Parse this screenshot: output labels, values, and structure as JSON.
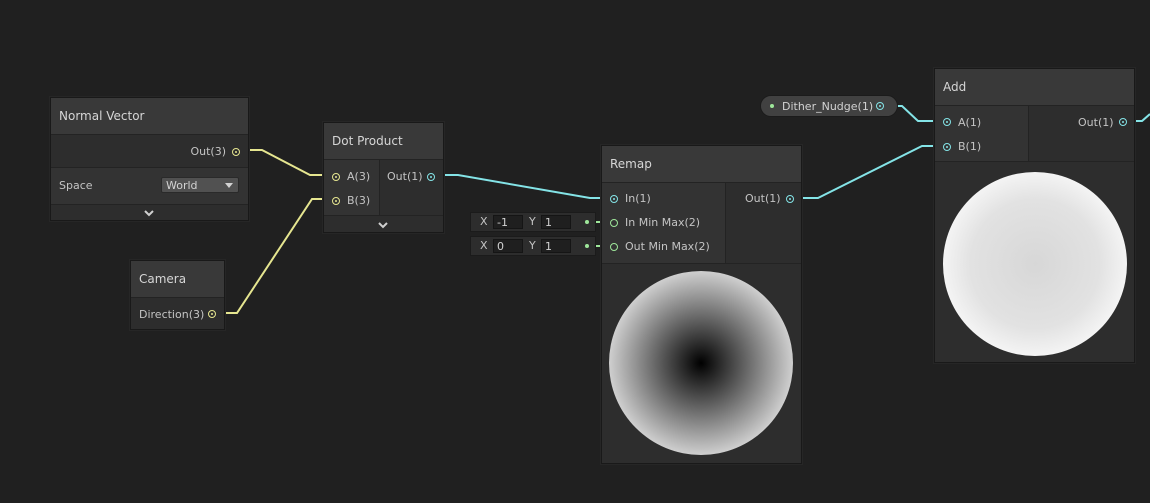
{
  "nodes": {
    "normal_vector": {
      "title": "Normal Vector",
      "out_label": "Out(3)",
      "space_label": "Space",
      "space_value": "World"
    },
    "camera": {
      "title": "Camera",
      "out_label": "Direction(3)"
    },
    "dot_product": {
      "title": "Dot Product",
      "in_a": "A(3)",
      "in_b": "B(3)",
      "out_label": "Out(1)"
    },
    "remap": {
      "title": "Remap",
      "in_label": "In(1)",
      "in_min_max_label": "In Min Max(2)",
      "out_min_max_label": "Out Min Max(2)",
      "out_label": "Out(1)",
      "in_min_max": {
        "x_label": "X",
        "x": "-1",
        "y_label": "Y",
        "y": "1"
      },
      "out_min_max": {
        "x_label": "X",
        "x": "0",
        "y_label": "Y",
        "y": "1"
      }
    },
    "dither_nudge": {
      "label": "Dither_Nudge(1)"
    },
    "add": {
      "title": "Add",
      "in_a": "A(1)",
      "in_b": "B(1)",
      "out_label": "Out(1)"
    }
  },
  "colors": {
    "vector3_wire": "#e6e690",
    "float_wire": "#84e4e7",
    "vector2_port": "#9ee79a",
    "background": "#202020"
  },
  "icons": [
    "chevron-down-icon",
    "dropdown-arrow-icon",
    "port-icon"
  ]
}
